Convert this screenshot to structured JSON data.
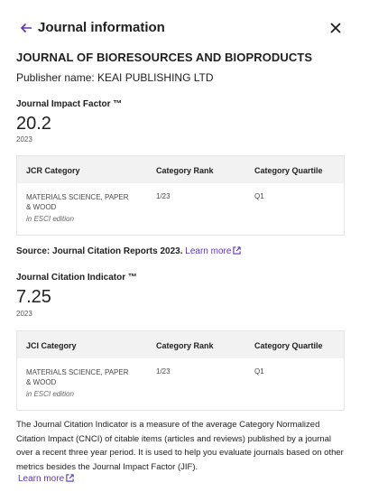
{
  "header": {
    "title": "Journal information",
    "back_icon": "arrow-left-icon",
    "close_icon": "close-icon",
    "accent_color": "#5e33bf"
  },
  "journal": {
    "name": "JOURNAL OF BIORESOURCES AND BIOPRODUCTS",
    "publisher": "Publisher name: KEAI PUBLISHING LTD"
  },
  "jif": {
    "title": "Journal Impact Factor ™",
    "value": "20.2",
    "year": "2023",
    "table": {
      "headers": [
        "JCR Category",
        "Category Rank",
        "Category Quartile"
      ],
      "rows": [
        {
          "category": "MATERIALS SCIENCE, PAPER & WOOD",
          "edition": "in ESCI edition",
          "rank": "1/23",
          "quartile": "Q1"
        }
      ]
    }
  },
  "source": {
    "text": "Source: Journal Citation Reports  2023.",
    "link": "Learn more",
    "link_icon": "external-link-icon"
  },
  "jci": {
    "title": "Journal Citation Indicator ™",
    "value": "7.25",
    "year": "2023",
    "table": {
      "headers": [
        "JCI Category",
        "Category Rank",
        "Category Quartile"
      ],
      "rows": [
        {
          "category": "MATERIALS SCIENCE, PAPER & WOOD",
          "edition": "in ESCI edition",
          "rank": "1/23",
          "quartile": "Q1"
        }
      ]
    }
  },
  "description": {
    "text": "The Journal Citation Indicator is a measure of the average Category Normalized Citation Impact (CNCI) of citable items (articles and reviews) published by a journal over a recent three year period. It is used to help you evaluate journals based on other metrics besides the Journal Impact Factor (JIF).",
    "link": "Learn more"
  }
}
